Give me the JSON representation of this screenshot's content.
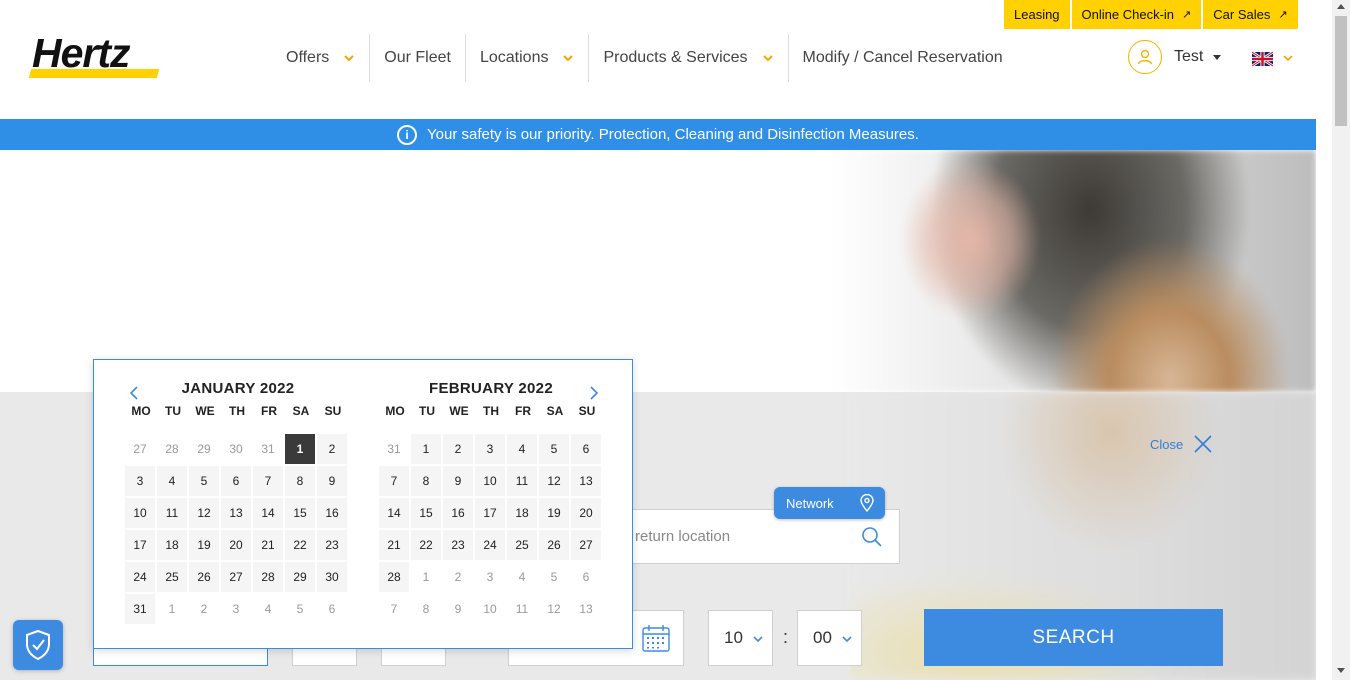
{
  "header": {
    "logo_text": "Hertz",
    "nav": [
      {
        "label": "Offers",
        "has_dropdown": true
      },
      {
        "label": "Our Fleet",
        "has_dropdown": false
      },
      {
        "label": "Locations",
        "has_dropdown": true
      },
      {
        "label": "Products & Services",
        "has_dropdown": true
      },
      {
        "label": "Modify / Cancel Reservation",
        "has_dropdown": false
      }
    ],
    "top_links": [
      "Leasing",
      "Online Check-in",
      "Car Sales"
    ],
    "user_name": "Test",
    "language_flag": "uk-flag-icon"
  },
  "banner": {
    "text": "Your safety is our priority. Protection, Cleaning and Disinfection Measures."
  },
  "booking": {
    "close_label": "Close",
    "network_label": "Network",
    "return_location_placeholder": "return location",
    "hour": "10",
    "minute": "00",
    "time_separator": ":",
    "search_label": "SEARCH"
  },
  "calendar": {
    "weekdays": [
      "MO",
      "TU",
      "WE",
      "TH",
      "FR",
      "SA",
      "SU"
    ],
    "months": [
      {
        "title": "JANUARY 2022",
        "days": [
          {
            "d": "27",
            "other": true
          },
          {
            "d": "28",
            "other": true
          },
          {
            "d": "29",
            "other": true
          },
          {
            "d": "30",
            "other": true
          },
          {
            "d": "31",
            "other": true
          },
          {
            "d": "1",
            "selected": true
          },
          {
            "d": "2"
          },
          {
            "d": "3"
          },
          {
            "d": "4"
          },
          {
            "d": "5"
          },
          {
            "d": "6"
          },
          {
            "d": "7"
          },
          {
            "d": "8"
          },
          {
            "d": "9"
          },
          {
            "d": "10"
          },
          {
            "d": "11"
          },
          {
            "d": "12"
          },
          {
            "d": "13"
          },
          {
            "d": "14"
          },
          {
            "d": "15"
          },
          {
            "d": "16"
          },
          {
            "d": "17"
          },
          {
            "d": "18"
          },
          {
            "d": "19"
          },
          {
            "d": "20"
          },
          {
            "d": "21"
          },
          {
            "d": "22"
          },
          {
            "d": "23"
          },
          {
            "d": "24"
          },
          {
            "d": "25"
          },
          {
            "d": "26"
          },
          {
            "d": "27"
          },
          {
            "d": "28"
          },
          {
            "d": "29"
          },
          {
            "d": "30"
          },
          {
            "d": "31"
          },
          {
            "d": "1",
            "other": true
          },
          {
            "d": "2",
            "other": true
          },
          {
            "d": "3",
            "other": true
          },
          {
            "d": "4",
            "other": true
          },
          {
            "d": "5",
            "other": true
          },
          {
            "d": "6",
            "other": true
          }
        ]
      },
      {
        "title": "FEBRUARY 2022",
        "days": [
          {
            "d": "31",
            "other": true
          },
          {
            "d": "1"
          },
          {
            "d": "2"
          },
          {
            "d": "3"
          },
          {
            "d": "4"
          },
          {
            "d": "5"
          },
          {
            "d": "6"
          },
          {
            "d": "7"
          },
          {
            "d": "8"
          },
          {
            "d": "9"
          },
          {
            "d": "10"
          },
          {
            "d": "11"
          },
          {
            "d": "12"
          },
          {
            "d": "13"
          },
          {
            "d": "14"
          },
          {
            "d": "15"
          },
          {
            "d": "16"
          },
          {
            "d": "17"
          },
          {
            "d": "18"
          },
          {
            "d": "19"
          },
          {
            "d": "20"
          },
          {
            "d": "21"
          },
          {
            "d": "22"
          },
          {
            "d": "23"
          },
          {
            "d": "24"
          },
          {
            "d": "25"
          },
          {
            "d": "26"
          },
          {
            "d": "27"
          },
          {
            "d": "28"
          },
          {
            "d": "1",
            "other": true
          },
          {
            "d": "2",
            "other": true
          },
          {
            "d": "3",
            "other": true
          },
          {
            "d": "4",
            "other": true
          },
          {
            "d": "5",
            "other": true
          },
          {
            "d": "6",
            "other": true
          },
          {
            "d": "7",
            "other": true
          },
          {
            "d": "8",
            "other": true
          },
          {
            "d": "9",
            "other": true
          },
          {
            "d": "10",
            "other": true
          },
          {
            "d": "11",
            "other": true
          },
          {
            "d": "12",
            "other": true
          },
          {
            "d": "13",
            "other": true
          }
        ]
      }
    ]
  },
  "colors": {
    "brand_yellow": "#ffd100",
    "accent_blue": "#3d8be0",
    "banner_blue": "#2f8fe7",
    "selected_day": "#3a3a3a"
  }
}
